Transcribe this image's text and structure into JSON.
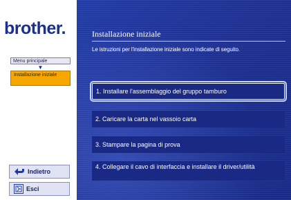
{
  "sidebar": {
    "logo": "brother.",
    "breadcrumb": {
      "menu": "Menu principale",
      "current": "Installazione iniziale"
    },
    "back_label": "Indietro",
    "exit_label": "Esci"
  },
  "main": {
    "title": "Installazione iniziale",
    "subtitle": "Le istruzioni per l'installazione iniziale sono indicate di seguito.",
    "steps": [
      {
        "label": "1. Installare l'assemblaggio del gruppo tamburo"
      },
      {
        "label": "2. Caricare la carta nel vassoio carta"
      },
      {
        "label": "3. Stampare la pagina di prova"
      },
      {
        "label": "4. Collegare il cavo di interfaccia e installare il driver/utilità"
      }
    ]
  },
  "colors": {
    "panel_bg": "#1f3296",
    "breadcrumb_active": "#f6a800",
    "logo": "#1b2f8f"
  },
  "icons": [
    "back-arrow-icon",
    "exit-door-icon",
    "down-arrow-icon"
  ]
}
